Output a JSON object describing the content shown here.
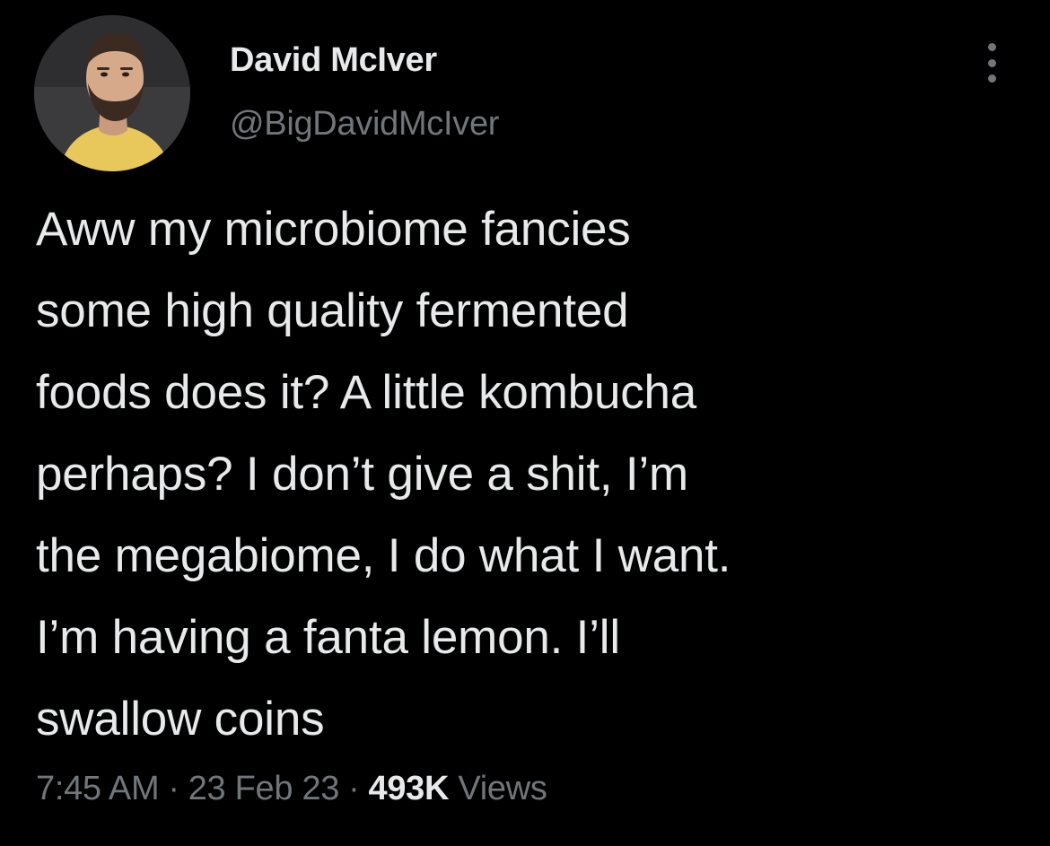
{
  "author": {
    "display_name": "David McIver",
    "handle": "@BigDavidMcIver",
    "avatar_icon": "profile-photo"
  },
  "tweet": {
    "text_lines": [
      "Aww my microbiome fancies",
      "some high quality fermented",
      "foods does it? A little kombucha",
      "perhaps? I don’t give a shit, I’m",
      "the megabiome, I do what I want.",
      "I’m having a fanta lemon. I’ll",
      "swallow coins"
    ]
  },
  "meta": {
    "time": "7:45 AM",
    "separator": "·",
    "date": "23 Feb 23",
    "views_count": "493K",
    "views_label": "Views"
  },
  "more_icon": "more-horizontal-icon",
  "colors": {
    "background": "#000000",
    "primary_text": "#e7e9ea",
    "secondary_text": "#71767b"
  }
}
